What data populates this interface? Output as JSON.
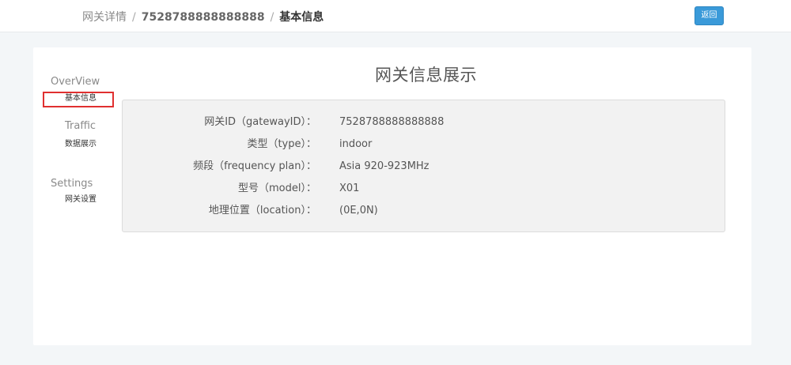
{
  "breadcrumb": {
    "root": "网关详情",
    "gateway_id": "7528788888888888",
    "current": "基本信息",
    "separator": "/"
  },
  "header": {
    "back_label": "返回"
  },
  "sidebar": {
    "groups": [
      {
        "header": "OverView",
        "items": [
          "基本信息"
        ]
      },
      {
        "header": "Traffic",
        "items": [
          "数据展示"
        ]
      },
      {
        "header": "Settings",
        "items": [
          "网关设置"
        ]
      }
    ],
    "active_item": "基本信息"
  },
  "main": {
    "title": "网关信息展示",
    "fields": [
      {
        "label": "网关ID（gatewayID）：",
        "value": "7528788888888888"
      },
      {
        "label": "类型（type）：",
        "value": "indoor"
      },
      {
        "label": "频段（frequency plan）：",
        "value": "Asia 920-923MHz"
      },
      {
        "label": "型号（model）：",
        "value": "X01"
      },
      {
        "label": "地理位置（location）：",
        "value": "(0E,0N)"
      }
    ]
  },
  "colors": {
    "accent": "#3a9ad9",
    "active_outline": "#e03030",
    "page_background": "#f3f6f8",
    "panel_background": "#f2f2f2"
  }
}
